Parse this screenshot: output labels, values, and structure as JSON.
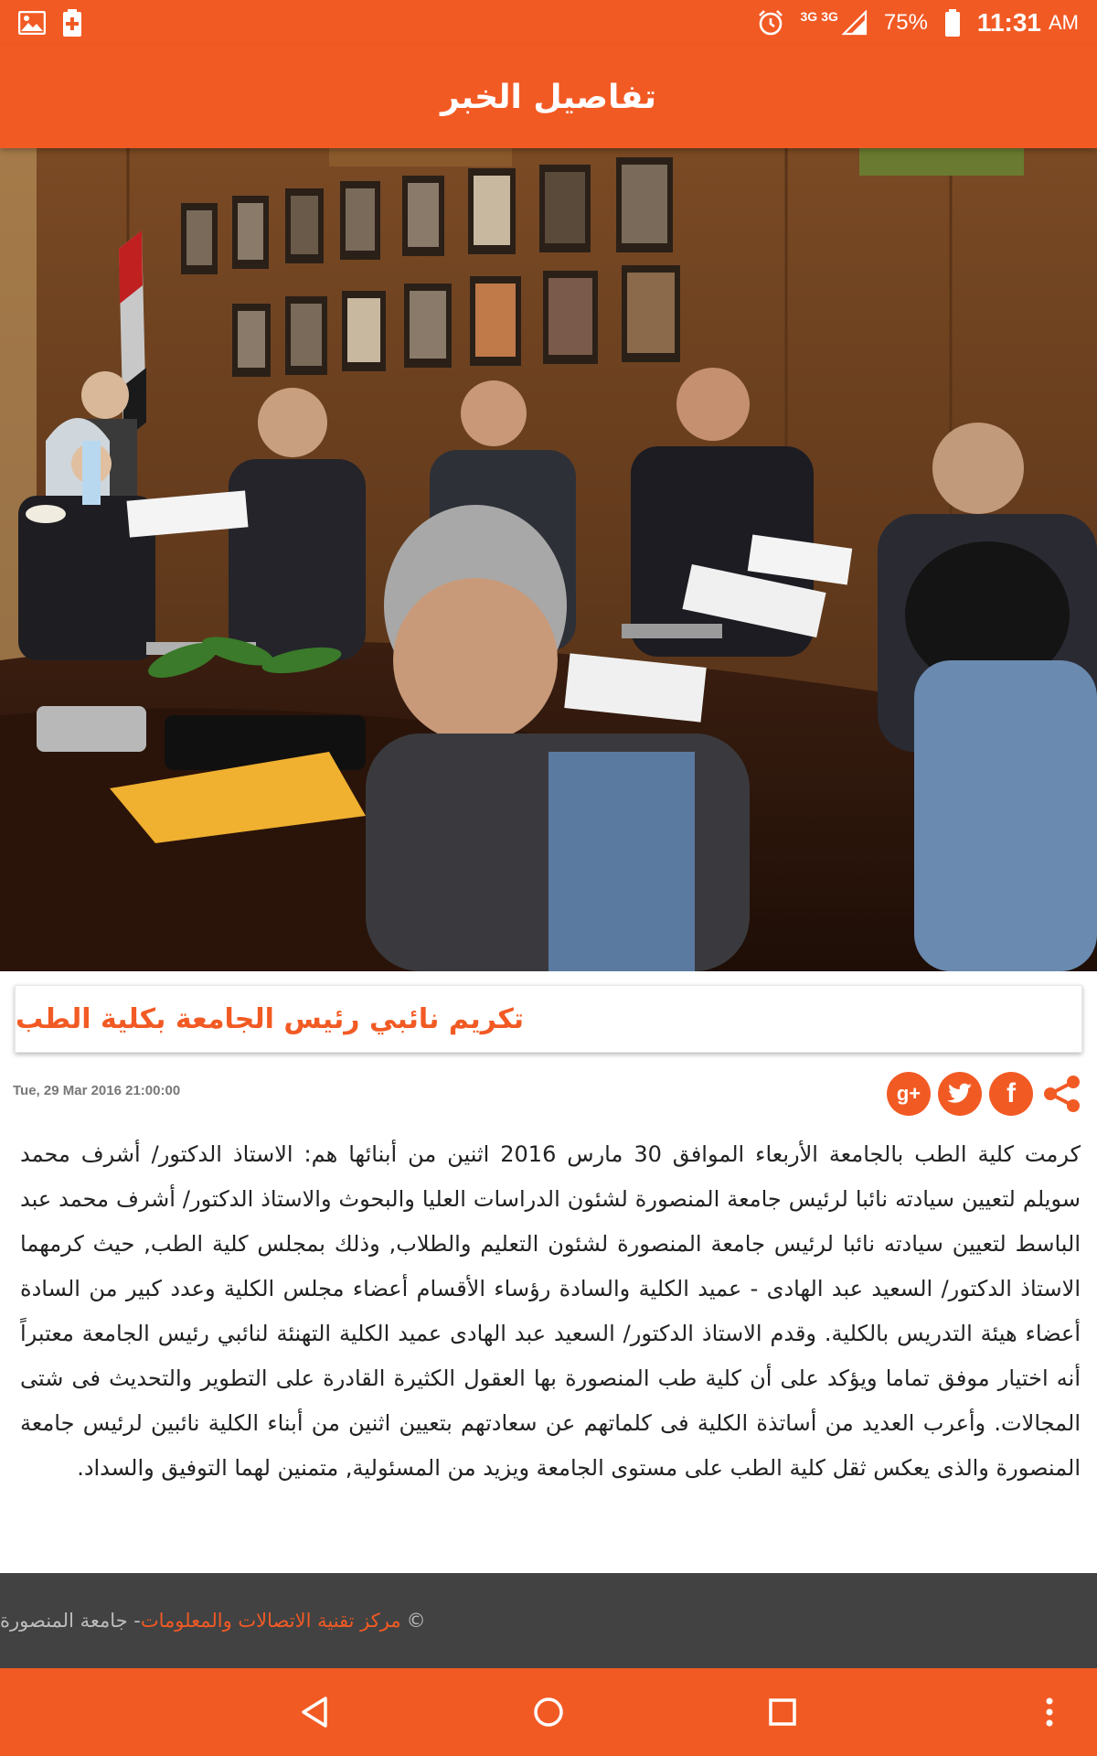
{
  "status_bar": {
    "battery": "75%",
    "time": "11:31",
    "ampm": "AM",
    "network_1": "3G",
    "network_2": "3G"
  },
  "app_bar": {
    "title": "تفاصيل الخبر"
  },
  "article": {
    "headline": "تكريم نائبي رئيس الجامعة بكلية الطب",
    "date": "Tue, 29 Mar 2016 21:00:00",
    "body": "كرمت كلية الطب بالجامعة الأربعاء الموافق 30 مارس 2016 اثنين من أبنائها هم: الاستاذ الدكتور/ أشرف محمد سويلم لتعيين سيادته نائبا لرئيس جامعة المنصورة لشئون الدراسات العليا والبحوث والاستاذ الدكتور/ أشرف محمد عبد الباسط لتعيين سيادته نائبا لرئيس جامعة المنصورة لشئون التعليم والطلاب, وذلك بمجلس كلية الطب, حيث كرمهما الاستاذ الدكتور/ السعيد عبد الهادى - عميد الكلية والسادة رؤساء الأقسام أعضاء مجلس الكلية وعدد كبير من السادة أعضاء هيئة التدريس بالكلية.        وقدم الاستاذ الدكتور/ السعيد عبد الهادى عميد الكلية التهنئة لنائبي رئيس الجامعة معتبراً أنه اختيار موفق تماما ويؤكد على أن كلية طب المنصورة بها العقول الكثيرة القادرة على التطوير والتحديث فى شتى المجالات.        وأعرب العديد من أساتذة الكلية فى كلماتهم عن سعادتهم بتعيين اثنين من أبناء الكلية نائبين لرئيس جامعة المنصورة والذى يعكس ثقل كلية الطب على مستوى الجامعة ويزيد من المسئولية, متمنين لهما التوفيق والسداد."
  },
  "share": {
    "google_plus": "g+",
    "twitter": "twitter-icon",
    "facebook": "f",
    "share": "share-icon"
  },
  "footer": {
    "copyright": "©",
    "link_text": "مركز تقنية الاتصالات والمعلومات",
    "suffix": " - جامعة المنصورة"
  },
  "colors": {
    "accent": "#f25a24",
    "footer_bg": "#424242",
    "footer_text": "#bdbdbd"
  }
}
